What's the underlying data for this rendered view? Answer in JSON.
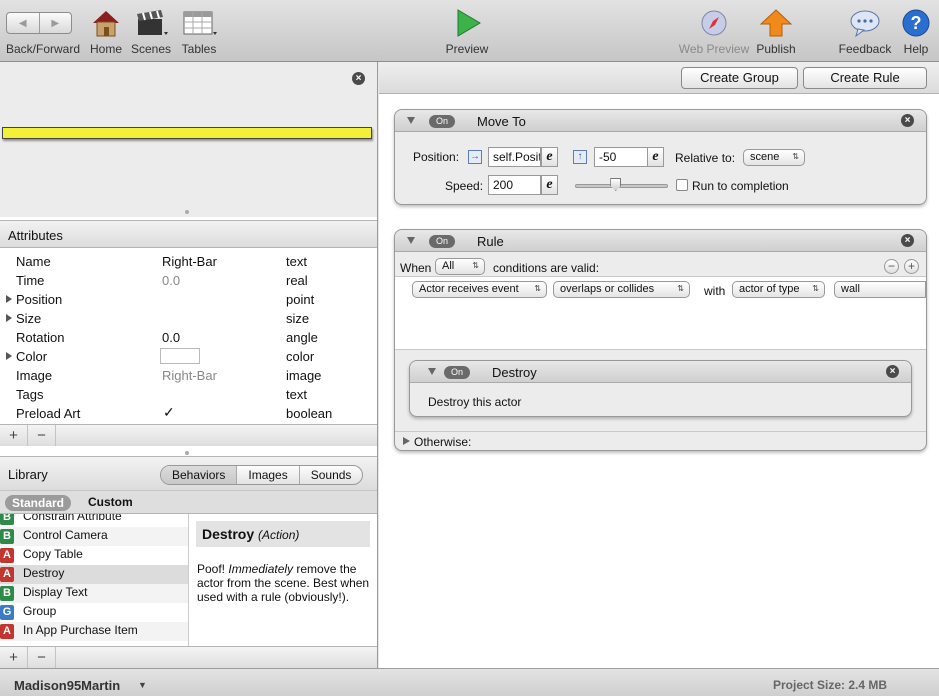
{
  "toolbar": {
    "back_forward": "Back/Forward",
    "home": "Home",
    "scenes": "Scenes",
    "tables": "Tables",
    "preview": "Preview",
    "web_preview": "Web Preview",
    "publish": "Publish",
    "feedback": "Feedback",
    "help": "Help"
  },
  "attributes": {
    "header": "Attributes",
    "rows": [
      {
        "name": "Name",
        "value": "Right-Bar",
        "type": "text"
      },
      {
        "name": "Time",
        "value": "0.0",
        "type": "real"
      },
      {
        "name": "Position",
        "value": "",
        "type": "point"
      },
      {
        "name": "Size",
        "value": "",
        "type": "size"
      },
      {
        "name": "Rotation",
        "value": "0.0",
        "type": "angle"
      },
      {
        "name": "Color",
        "value": "",
        "type": "color"
      },
      {
        "name": "Image",
        "value": "Right-Bar",
        "type": "image"
      },
      {
        "name": "Tags",
        "value": "",
        "type": "text"
      },
      {
        "name": "Preload Art",
        "value": "✓",
        "type": "boolean"
      }
    ],
    "color_value": "#ffffff",
    "add": "+",
    "remove": "−"
  },
  "library": {
    "title": "Library",
    "tabs": [
      "Behaviors",
      "Images",
      "Sounds"
    ],
    "active_tab": "Behaviors",
    "sub_tabs": [
      "Standard",
      "Custom"
    ],
    "items": [
      {
        "badge": "B",
        "label": "Constrain Attribute"
      },
      {
        "badge": "B",
        "label": "Control Camera"
      },
      {
        "badge": "A",
        "label": "Copy Table"
      },
      {
        "badge": "A",
        "label": "Destroy"
      },
      {
        "badge": "B",
        "label": "Display Text"
      },
      {
        "badge": "G",
        "label": "Group"
      },
      {
        "badge": "A",
        "label": "In App Purchase Item"
      }
    ],
    "selected": "Destroy",
    "desc_title": "Destroy",
    "desc_kind": "(Action)",
    "desc_pre": "Poof! ",
    "desc_em": "Immediately",
    "desc_post": " remove the actor from the scene. Best when used with a rule (obviously!).",
    "add": "+",
    "remove": "−"
  },
  "editor": {
    "create_group": "Create Group",
    "create_rule": "Create Rule",
    "move_to": {
      "on": "On",
      "title": "Move To",
      "position_label": "Position:",
      "x_value": "self.Posit",
      "y_value": "-50",
      "relative_label": "Relative to:",
      "relative_value": "scene",
      "speed_label": "Speed:",
      "speed_value": "200",
      "slider_fraction": 0.43,
      "run_to_completion": "Run to completion",
      "expr_btn": "e"
    },
    "rule": {
      "on": "On",
      "title": "Rule",
      "when": "When",
      "all": "All",
      "conditions_text": "conditions are valid:",
      "cond_1": "Actor receives event",
      "cond_2": "overlaps or collides",
      "with": "with",
      "cond_3": "actor of type",
      "cond_4": "wall",
      "destroy": {
        "on": "On",
        "title": "Destroy",
        "body": "Destroy this actor"
      },
      "otherwise": "Otherwise:"
    }
  },
  "status": {
    "user": "Madison95Martin",
    "project_size": "Project Size: 2.4 MB"
  },
  "colors": {
    "bar_fill": "#f4f03a",
    "preview_green": "#3bb24a",
    "publish_orange": "#f08a1c",
    "help_blue": "#2a6fcf"
  }
}
